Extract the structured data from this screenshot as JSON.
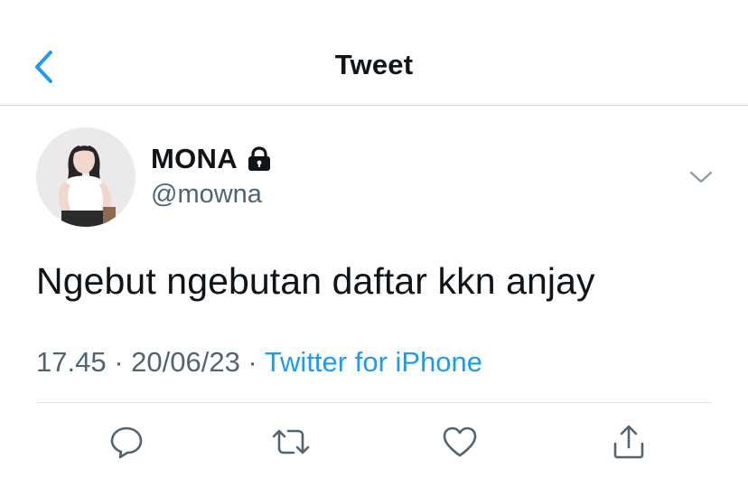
{
  "header": {
    "title": "Tweet",
    "back_icon": "chevron-left-icon"
  },
  "author": {
    "name": "MONA",
    "handle": "@mowna",
    "locked": true,
    "lock_icon": "lock-icon"
  },
  "tweet": {
    "text": "Ngebut ngebutan daftar kkn anjay",
    "time": "17.45",
    "date": "20/06/23",
    "source": "Twitter for iPhone",
    "separator": " · "
  },
  "actions": [
    "reply-icon",
    "retweet-icon",
    "like-icon",
    "share-icon"
  ],
  "colors": {
    "accent": "#1d9bf0",
    "muted": "#536471",
    "text": "#0f1419",
    "divider": "#e1e4e6"
  }
}
